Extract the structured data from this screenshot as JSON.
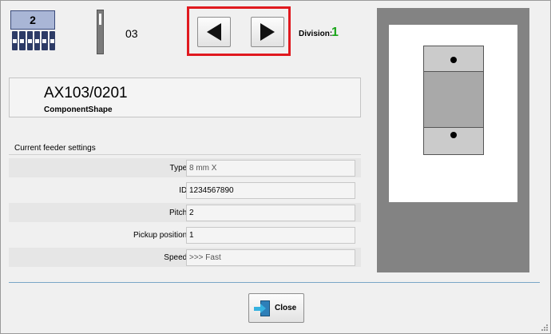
{
  "header": {
    "trolley_number": "2",
    "feeder_number": "03",
    "division_label": "Division:",
    "division_value": "1"
  },
  "component": {
    "name": "AX103/0201",
    "shape_label": "ComponentShape"
  },
  "settings": {
    "title": "Current feeder settings",
    "fields": [
      {
        "label": "Type:",
        "value": "8 mm X"
      },
      {
        "label": "ID:",
        "value": "1234567890"
      },
      {
        "label": "Pitch:",
        "value": "2"
      },
      {
        "label": "Pickup position:",
        "value": "1"
      },
      {
        "label": "Speed:",
        "value": ">>> Fast"
      }
    ]
  },
  "footer": {
    "close_label": "Close"
  },
  "icons": {
    "prev": "left-triangle-icon",
    "next": "right-triangle-icon",
    "close": "exit-door-icon",
    "trolley": "trolley-icon",
    "feeder": "feeder-icon"
  },
  "colors": {
    "highlight": "#e0191f",
    "division_value": "#1aa51a",
    "trolley_badge": "#a9b6d6",
    "preview_bg": "#838383"
  }
}
